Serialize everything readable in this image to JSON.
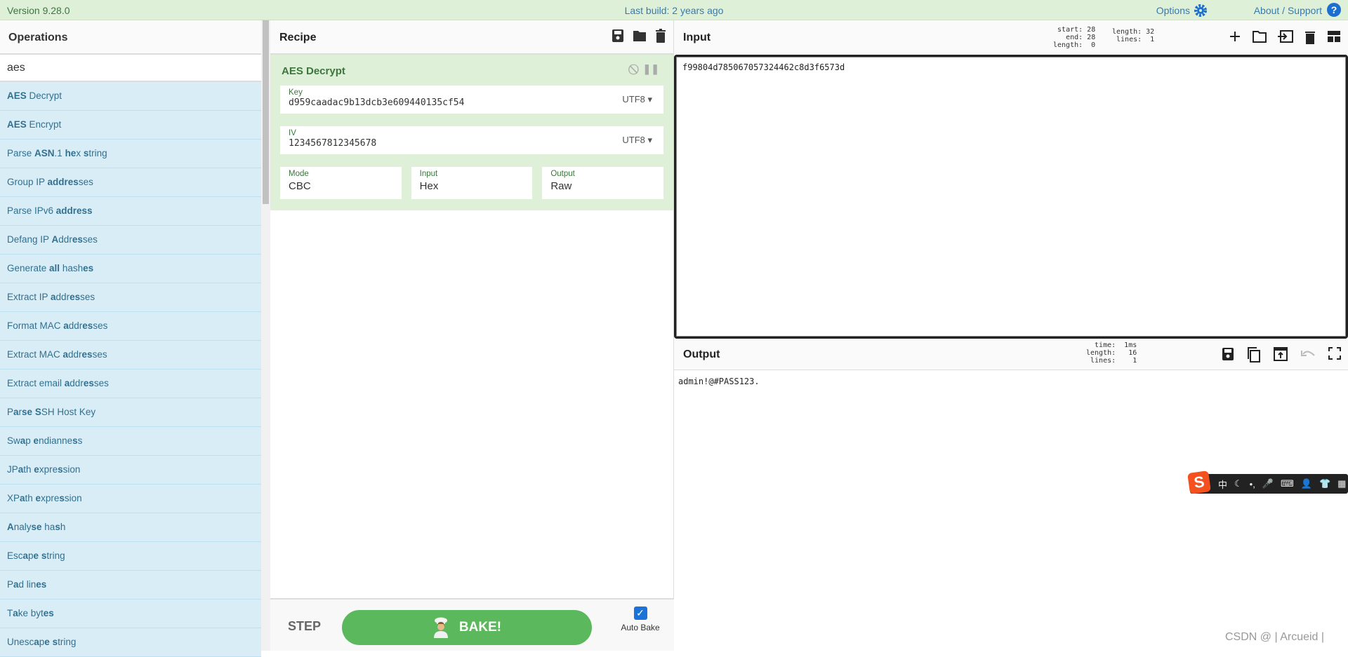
{
  "topbar": {
    "version": "Version 9.28.0",
    "last_build": "Last build: 2 years ago",
    "options": "Options",
    "about": "About / Support",
    "help": "?"
  },
  "operations": {
    "title": "Operations",
    "search_value": "aes",
    "items": [
      [
        [
          "AES",
          1
        ],
        [
          " Decrypt",
          0
        ]
      ],
      [
        [
          "AES",
          1
        ],
        [
          " Encrypt",
          0
        ]
      ],
      [
        [
          "Parse ",
          0
        ],
        [
          "ASN",
          1
        ],
        [
          ".1 ",
          0
        ],
        [
          "he",
          1
        ],
        [
          "x ",
          0
        ],
        [
          "s",
          1
        ],
        [
          "tring",
          0
        ]
      ],
      [
        [
          "Group IP ",
          0
        ],
        [
          "addres",
          1
        ],
        [
          "ses",
          0
        ]
      ],
      [
        [
          "Parse IPv6 ",
          0
        ],
        [
          "address",
          1
        ]
      ],
      [
        [
          "Defang IP ",
          0
        ],
        [
          "A",
          1
        ],
        [
          "ddr",
          0
        ],
        [
          "es",
          1
        ],
        [
          "ses",
          0
        ]
      ],
      [
        [
          "Generate ",
          0
        ],
        [
          "all",
          1
        ],
        [
          " hash",
          0
        ],
        [
          "es",
          1
        ]
      ],
      [
        [
          "Extract IP ",
          0
        ],
        [
          "a",
          1
        ],
        [
          "ddr",
          0
        ],
        [
          "es",
          1
        ],
        [
          "ses",
          0
        ]
      ],
      [
        [
          "Format MAC ",
          0
        ],
        [
          "a",
          1
        ],
        [
          "ddr",
          0
        ],
        [
          "es",
          1
        ],
        [
          "ses",
          0
        ]
      ],
      [
        [
          "Extract MAC ",
          0
        ],
        [
          "a",
          1
        ],
        [
          "ddr",
          0
        ],
        [
          "es",
          1
        ],
        [
          "ses",
          0
        ]
      ],
      [
        [
          "Extract email ",
          0
        ],
        [
          "a",
          1
        ],
        [
          "ddr",
          0
        ],
        [
          "es",
          1
        ],
        [
          "ses",
          0
        ]
      ],
      [
        [
          "P",
          0
        ],
        [
          "a",
          1
        ],
        [
          "r",
          0
        ],
        [
          "se",
          1
        ],
        [
          " ",
          0
        ],
        [
          "S",
          1
        ],
        [
          "SH Host Key",
          0
        ]
      ],
      [
        [
          "Sw",
          0
        ],
        [
          "a",
          1
        ],
        [
          "p ",
          0
        ],
        [
          "e",
          1
        ],
        [
          "ndianne",
          0
        ],
        [
          "s",
          1
        ],
        [
          "s",
          0
        ]
      ],
      [
        [
          "JP",
          0
        ],
        [
          "a",
          1
        ],
        [
          "th ",
          0
        ],
        [
          "e",
          1
        ],
        [
          "xpre",
          0
        ],
        [
          "s",
          1
        ],
        [
          "sion",
          0
        ]
      ],
      [
        [
          "XP",
          0
        ],
        [
          "a",
          1
        ],
        [
          "th ",
          0
        ],
        [
          "e",
          1
        ],
        [
          "xpre",
          0
        ],
        [
          "s",
          1
        ],
        [
          "sion",
          0
        ]
      ],
      [
        [
          "A",
          1
        ],
        [
          "naly",
          0
        ],
        [
          "se",
          1
        ],
        [
          " ha",
          0
        ],
        [
          "s",
          1
        ],
        [
          "h",
          0
        ]
      ],
      [
        [
          "Esc",
          0
        ],
        [
          "a",
          1
        ],
        [
          "p",
          0
        ],
        [
          "e",
          1
        ],
        [
          " ",
          0
        ],
        [
          "s",
          1
        ],
        [
          "tring",
          0
        ]
      ],
      [
        [
          "P",
          0
        ],
        [
          "a",
          1
        ],
        [
          "d lin",
          0
        ],
        [
          "es",
          1
        ]
      ],
      [
        [
          "T",
          0
        ],
        [
          "a",
          1
        ],
        [
          "ke byt",
          0
        ],
        [
          "es",
          1
        ]
      ],
      [
        [
          "Unesc",
          0
        ],
        [
          "a",
          1
        ],
        [
          "p",
          0
        ],
        [
          "e",
          1
        ],
        [
          " ",
          0
        ],
        [
          "s",
          1
        ],
        [
          "tring",
          0
        ]
      ]
    ]
  },
  "recipe": {
    "title": "Recipe",
    "operation": {
      "name": "AES Decrypt",
      "key": {
        "label": "Key",
        "value": "d959caadac9b13dcb3e609440135cf54",
        "encoding": "UTF8"
      },
      "iv": {
        "label": "IV",
        "value": "1234567812345678",
        "encoding": "UTF8"
      },
      "mode": {
        "label": "Mode",
        "value": "CBC"
      },
      "input": {
        "label": "Input",
        "value": "Hex"
      },
      "output": {
        "label": "Output",
        "value": "Raw"
      }
    },
    "step": "STEP",
    "bake": "BAKE!",
    "auto_bake": "Auto Bake",
    "auto_bake_checked": true
  },
  "input": {
    "title": "Input",
    "stats_left": "start: 28\n  end: 28\nlength:  0",
    "stats_right": "length: 32\n lines:  1",
    "value": "f99804d785067057324462c8d3f6573d"
  },
  "output": {
    "title": "Output",
    "stats": "  time:  1ms\nlength:   16\n lines:    1",
    "value": "admin!@#PASS123."
  },
  "ime": {
    "logo": "S",
    "chars": [
      "中",
      "☾",
      "•,",
      "🎤",
      "⌨",
      "👤",
      "👕",
      "▦"
    ]
  },
  "watermark": "CSDN @ | Arcueid |",
  "colors": {
    "accent_green": "#5cb85c",
    "op_bg": "#d9edf7",
    "recipe_bg": "#dff0d8",
    "link": "#337ab7"
  }
}
